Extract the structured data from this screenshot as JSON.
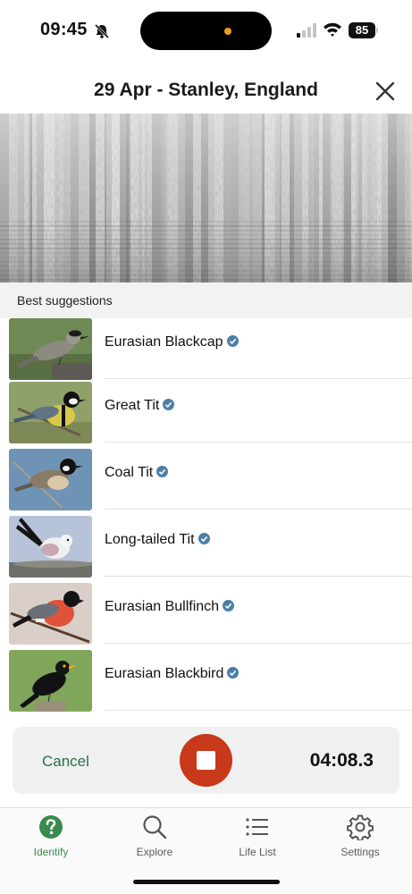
{
  "status_bar": {
    "time": "09:45",
    "battery": "85",
    "island_dot_color": "#f29a1f"
  },
  "header": {
    "title": "29 Apr - Stanley, England"
  },
  "suggestions": {
    "section_label": "Best suggestions",
    "items": [
      {
        "name": "Eurasian Blackcap",
        "verified": true
      },
      {
        "name": "Great Tit",
        "verified": true
      },
      {
        "name": "Coal Tit",
        "verified": true
      },
      {
        "name": "Long-tailed Tit",
        "verified": true
      },
      {
        "name": "Eurasian Bullfinch",
        "verified": true
      },
      {
        "name": "Eurasian Blackbird",
        "verified": true
      }
    ]
  },
  "recorder": {
    "cancel_label": "Cancel",
    "timer": "04:08.3",
    "stop_color": "#c7391a"
  },
  "tabbar": {
    "tabs": [
      {
        "label": "Identify",
        "icon": "question-circle-icon",
        "active": true
      },
      {
        "label": "Explore",
        "icon": "search-icon",
        "active": false
      },
      {
        "label": "Life List",
        "icon": "list-icon",
        "active": false
      },
      {
        "label": "Settings",
        "icon": "gear-icon",
        "active": false
      }
    ]
  },
  "colors": {
    "accent_green": "#3a8a4f",
    "verified_blue": "#4a7fa8"
  }
}
